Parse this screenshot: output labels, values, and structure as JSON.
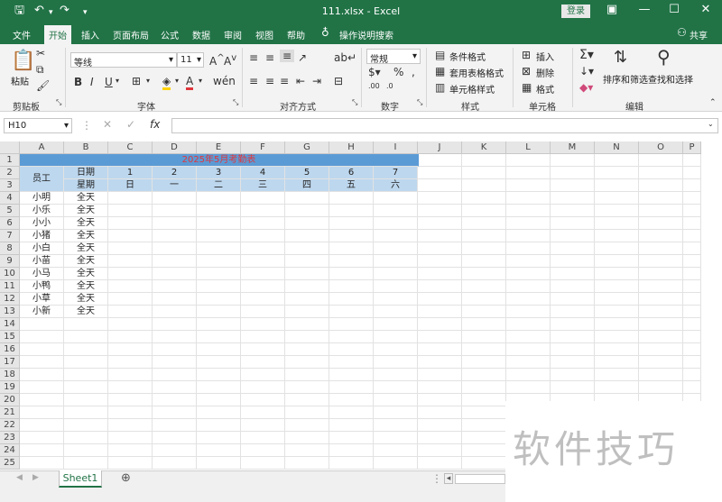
{
  "titlebar": {
    "title": "111.xlsx  -  Excel",
    "login": "登录"
  },
  "tabs": [
    "文件",
    "开始",
    "插入",
    "页面布局",
    "公式",
    "数据",
    "审阅",
    "视图",
    "帮助",
    "操作说明搜索",
    "共享"
  ],
  "ribbon": {
    "clipboard": {
      "paste": "粘贴",
      "label": "剪贴板"
    },
    "font": {
      "name": "等线",
      "size": "11",
      "label": "字体",
      "bold": "B",
      "italic": "I",
      "underline": "U"
    },
    "align": {
      "label": "对齐方式"
    },
    "number": {
      "format": "常规",
      "label": "数字"
    },
    "styles": {
      "cond": "条件格式",
      "table": "套用表格格式",
      "cell": "单元格样式",
      "label": "样式"
    },
    "cells": {
      "insert": "插入",
      "delete": "删除",
      "format": "格式",
      "label": "单元格"
    },
    "editing": {
      "sort": "排序和筛选",
      "find": "查找和选择",
      "label": "编辑"
    }
  },
  "namebox": "H10",
  "fx": "fx",
  "columns": [
    "A",
    "B",
    "C",
    "D",
    "E",
    "F",
    "G",
    "H",
    "I",
    "J",
    "K",
    "L",
    "M",
    "N",
    "O",
    "P"
  ],
  "rows": [
    "1",
    "2",
    "3",
    "4",
    "5",
    "6",
    "7",
    "8",
    "9",
    "10",
    "11",
    "12",
    "13",
    "14",
    "15",
    "16",
    "17",
    "18",
    "19",
    "20",
    "21",
    "22",
    "23",
    "24",
    "25"
  ],
  "sheet": {
    "title": "2025年5月考勤表",
    "header_employee": "员工",
    "header_date": "日期",
    "header_week": "星期",
    "days": [
      "1",
      "2",
      "3",
      "4",
      "5",
      "6",
      "7"
    ],
    "weekdays": [
      "日",
      "一",
      "二",
      "三",
      "四",
      "五",
      "六"
    ],
    "employees": [
      "小明",
      "小乐",
      "小小",
      "小猪",
      "小白",
      "小苗",
      "小马",
      "小鸭",
      "小草",
      "小新"
    ],
    "attendance": [
      "全天",
      "全天",
      "全天",
      "全天",
      "全天",
      "全天",
      "全天",
      "全天",
      "全天",
      "全天"
    ]
  },
  "sheet_tab": "Sheet1",
  "watermark": "软件技巧",
  "colors": {
    "excel_green": "#217346",
    "header_fill": "#5b9bd5",
    "subheader_fill": "#bdd7ee",
    "title_text": "#e0363d"
  }
}
